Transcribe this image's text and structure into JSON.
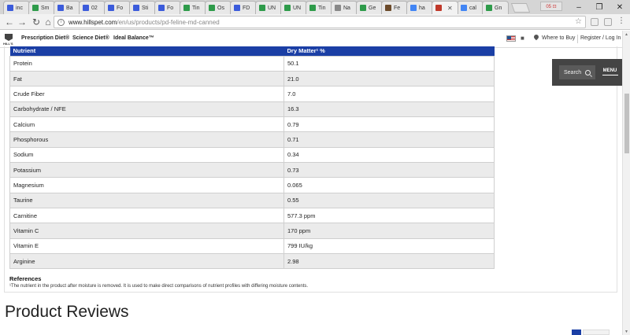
{
  "browser": {
    "tabs": [
      {
        "label": "inc",
        "color": "#3b5bdb"
      },
      {
        "label": "Sm",
        "color": "#2e9b4a"
      },
      {
        "label": "Ba",
        "color": "#3b5bdb"
      },
      {
        "label": "02",
        "color": "#3b5bdb"
      },
      {
        "label": "Fo",
        "color": "#3b5bdb"
      },
      {
        "label": "Sti",
        "color": "#3b5bdb"
      },
      {
        "label": "Fo",
        "color": "#3b5bdb"
      },
      {
        "label": "Tin",
        "color": "#2e9b4a"
      },
      {
        "label": "Os",
        "color": "#2e9b4a"
      },
      {
        "label": "FD",
        "color": "#3b5bdb"
      },
      {
        "label": "UN",
        "color": "#2e9b4a"
      },
      {
        "label": "UN",
        "color": "#2e9b4a"
      },
      {
        "label": "Tin",
        "color": "#2e9b4a"
      },
      {
        "label": "Na",
        "color": "#888888"
      },
      {
        "label": "Ge",
        "color": "#2e9b4a"
      },
      {
        "label": "Fe",
        "color": "#6b4a2a"
      },
      {
        "label": "ha",
        "color": "#4285f4"
      },
      {
        "label": "",
        "color": "#c0392b",
        "active": true
      },
      {
        "label": "cal",
        "color": "#4285f4"
      },
      {
        "label": "Gn",
        "color": "#2e9b4a"
      }
    ],
    "profile_badge": "05 ⊡",
    "url_host": "www.hillspet.com",
    "url_path": "/en/us/products/pd-feline-md-canned"
  },
  "site": {
    "logo_text": "HILL'S",
    "nav": [
      "Prescription Diet®",
      "Science Diet®",
      "Ideal Balance™"
    ],
    "where_to_buy": "Where to Buy",
    "register": "Register / Log In",
    "search_label": "Search",
    "menu_label": "MENU"
  },
  "nutrients": {
    "header_name": "Nutrient",
    "header_value": "Dry Matter¹ %",
    "rows": [
      {
        "name": "Protein",
        "value": "50.1"
      },
      {
        "name": "Fat",
        "value": "21.0"
      },
      {
        "name": "Crude Fiber",
        "value": "7.0"
      },
      {
        "name": "Carbohydrate / NFE",
        "value": "16.3"
      },
      {
        "name": "Calcium",
        "value": "0.79"
      },
      {
        "name": "Phosphorous",
        "value": "0.71"
      },
      {
        "name": "Sodium",
        "value": "0.34"
      },
      {
        "name": "Potassium",
        "value": "0.73"
      },
      {
        "name": "Magnesium",
        "value": "0.065"
      },
      {
        "name": "Taurine",
        "value": "0.55"
      },
      {
        "name": "Carnitine",
        "value": "577.3 ppm"
      },
      {
        "name": "Vitamin C",
        "value": "170 ppm"
      },
      {
        "name": "Vitamin E",
        "value": "799 IU/kg"
      },
      {
        "name": "Arginine",
        "value": "2.98"
      }
    ]
  },
  "references": {
    "title": "References",
    "note": "¹The nutrient in the product after moisture is removed. It is used to make direct comparisons of nutrient profiles with differing moisture contents."
  },
  "reviews": {
    "title": "Product Reviews"
  }
}
